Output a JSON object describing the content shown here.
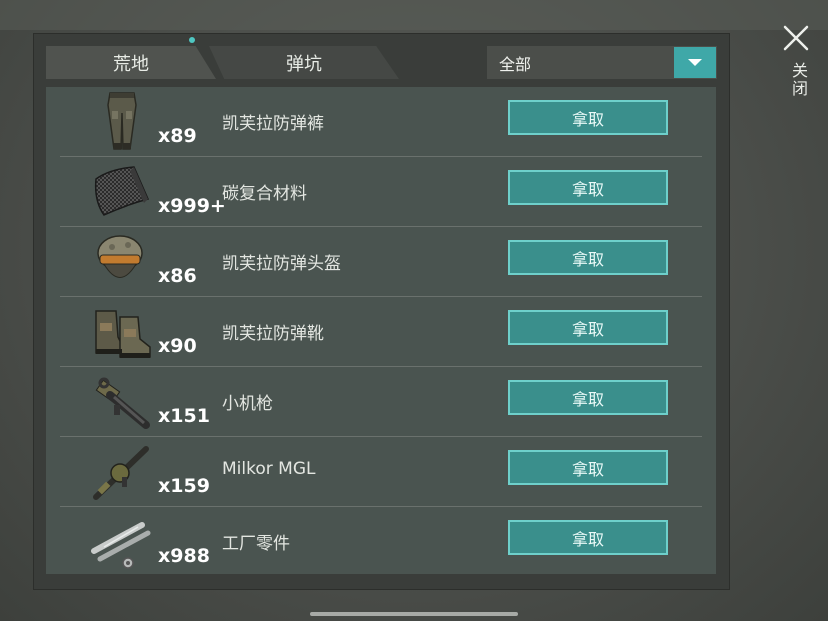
{
  "tabs": [
    {
      "label": "荒地",
      "active": true,
      "has_dot": true
    },
    {
      "label": "弹坑",
      "active": false
    }
  ],
  "filter": {
    "selected": "全部"
  },
  "close": {
    "label": "关闭"
  },
  "take_label": "拿取",
  "items": [
    {
      "icon": "pants-icon",
      "qty": "x89",
      "name": "凯芙拉防弹裤"
    },
    {
      "icon": "carbon-sheet-icon",
      "qty": "x999+",
      "name": "碳复合材料"
    },
    {
      "icon": "helmet-icon",
      "qty": "x86",
      "name": "凯芙拉防弹头盔"
    },
    {
      "icon": "boots-icon",
      "qty": "x90",
      "name": "凯芙拉防弹靴"
    },
    {
      "icon": "machine-gun-icon",
      "qty": "x151",
      "name": "小机枪"
    },
    {
      "icon": "grenade-launcher-icon",
      "qty": "x159",
      "name": "Milkor MGL"
    },
    {
      "icon": "factory-parts-icon",
      "qty": "x988",
      "name": "工厂零件"
    }
  ],
  "colors": {
    "accent": "#3fa8a8",
    "button_border": "#6ed0cb",
    "panel": "#3a3d3a",
    "list_bg": "#4a5450"
  }
}
